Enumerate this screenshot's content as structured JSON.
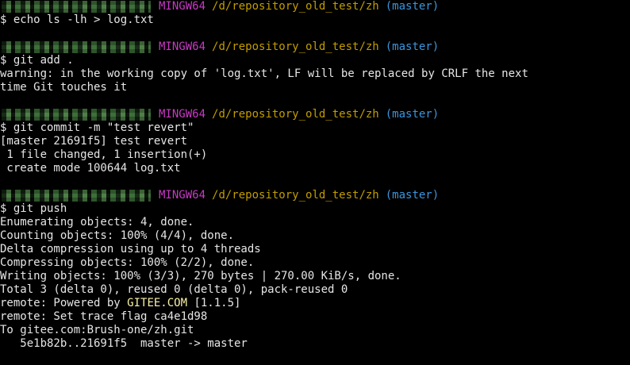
{
  "colors": {
    "background": "#000000",
    "text": "#e6e6e6",
    "mingw": "#c839c5",
    "path": "#c19c00",
    "branch": "#3a96dd",
    "highlight": "#f9f1a5"
  },
  "prompt": {
    "system": "MINGW64",
    "path": "/d/repository_old_test/zh",
    "branch": "(master)"
  },
  "blocks": [
    {
      "command": "$ echo ls -lh > log.txt",
      "output": []
    },
    {
      "command": "$ git add .",
      "output": [
        "warning: in the working copy of 'log.txt', LF will be replaced by CRLF the next",
        "time Git touches it"
      ]
    },
    {
      "command": "$ git commit -m \"test revert\"",
      "output": [
        "[master 21691f5] test revert",
        " 1 file changed, 1 insertion(+)",
        " create mode 100644 log.txt"
      ]
    },
    {
      "command": "$ git push",
      "output": [
        "Enumerating objects: 4, done.",
        "Counting objects: 100% (4/4), done.",
        "Delta compression using up to 4 threads",
        "Compressing objects: 100% (2/2), done.",
        "Writing objects: 100% (3/3), 270 bytes | 270.00 KiB/s, done.",
        "Total 3 (delta 0), reused 0 (delta 0), pack-reused 0"
      ],
      "remote_powered": {
        "prefix": "remote: Powered by ",
        "brand": "GITEE.COM",
        "suffix": " [1.1.5]"
      },
      "tail": [
        "remote: Set trace flag ca4e1d98",
        "To gitee.com:Brush-one/zh.git",
        "   5e1b82b..21691f5  master -> master"
      ]
    }
  ]
}
